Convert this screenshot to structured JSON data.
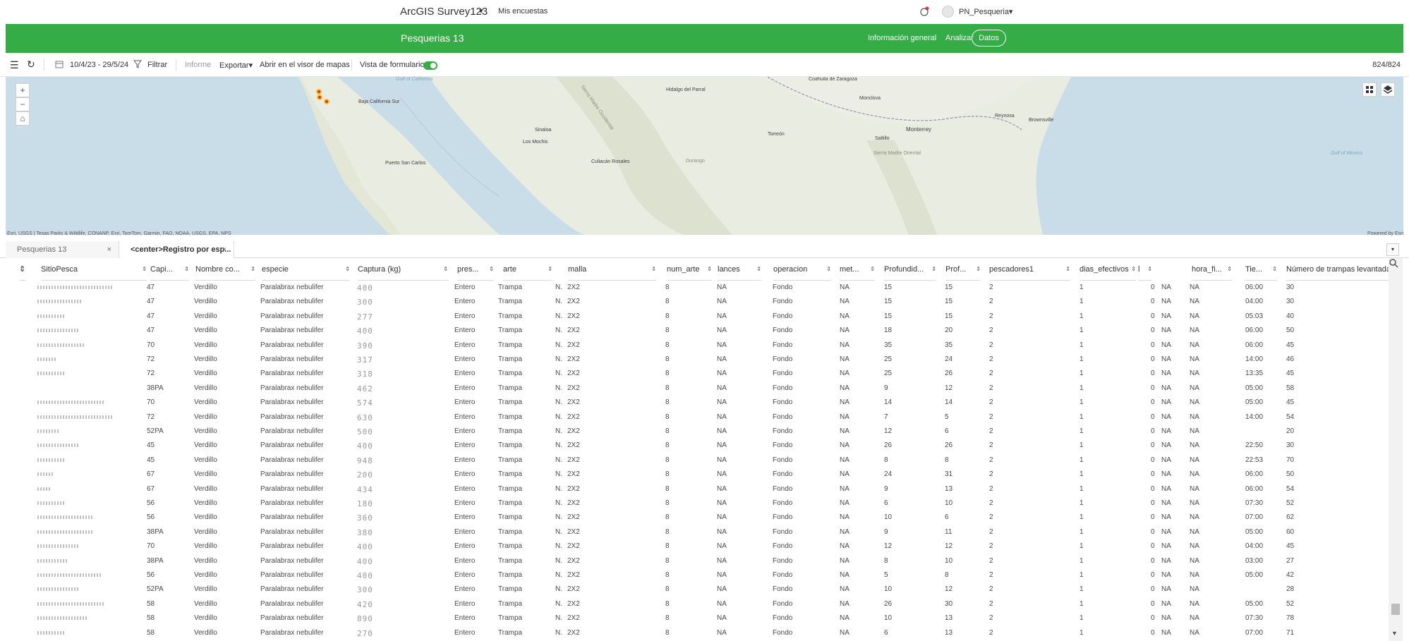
{
  "topbar": {
    "app_title": "ArcGIS Survey123",
    "app_caret": "▾",
    "mis_encuestas": "Mis encuestas",
    "user_name": "PN_Pesqueria▾"
  },
  "header": {
    "survey_title": "Pesquerias 13",
    "nav": {
      "info": "Información general",
      "analizar": "Analizar",
      "datos": "Datos"
    }
  },
  "toolbar": {
    "menu_icon": "☰",
    "refresh_icon": "↻",
    "date_range": "10/4/23 - 29/5/24",
    "filter": "Filtrar",
    "report": "Informe",
    "export": "Exportar▾",
    "open_map": "Abrir en el visor de mapas",
    "form_view": "Vista de formulario",
    "record_count": "824/824"
  },
  "map": {
    "zoom_in": "+",
    "zoom_out": "−",
    "home": "⌂",
    "labels": [
      {
        "text": "Gulf of California",
        "water": true
      },
      {
        "text": "Baja California Sur",
        "water": false
      },
      {
        "text": "Hidalgo del Parral",
        "water": false
      },
      {
        "text": "Coahuila de Zaragoza",
        "water": false
      },
      {
        "text": "Monclova",
        "water": false
      },
      {
        "text": "Sinaloa",
        "water": false
      },
      {
        "text": "Los Mochis",
        "water": false
      },
      {
        "text": "Sierra Madre Occidental",
        "water": false
      },
      {
        "text": "Reynosa",
        "water": false
      },
      {
        "text": "Brownsville",
        "water": false
      },
      {
        "text": "Monterrey",
        "water": false
      },
      {
        "text": "Torreón",
        "water": false
      },
      {
        "text": "Saltillo",
        "water": false
      },
      {
        "text": "Sierra Madre Oriental",
        "water": false
      },
      {
        "text": "Puerto San Carlos",
        "water": false
      },
      {
        "text": "Culiacán Rosales",
        "water": false
      },
      {
        "text": "Durango",
        "water": false
      },
      {
        "text": "Gulf of Mexico",
        "water": true
      }
    ],
    "attribution": "Esri, USGS | Texas Parks & Wildlife, CONANP, Esri, TomTom, Garmin, FAO, NOAA, USGS, EPA, NPS",
    "powered_by": "Powered by Esri"
  },
  "tabs": [
    {
      "label": "Pesquerias 13",
      "close": "×"
    },
    {
      "label": "<center>Registro por esp...",
      "close": "×"
    }
  ],
  "table": {
    "headers": [
      "SitioPesca",
      "Capi...",
      "Nombre co...",
      "especie",
      "Captura (kg)",
      "pres...",
      "arte",
      "malla",
      "num_arte",
      "lances",
      "operacion",
      "met...",
      "Profundid...",
      "Prof...",
      "pescadores1",
      "dias_efectivos",
      "l",
      "hora_fi...",
      "Tie...",
      "Número de trampas levantadas..."
    ],
    "sort_glyph": "⇕",
    "common": {
      "nombre": "Verdillo",
      "especie": "Paralabrax nebulifer",
      "pres": "Entero",
      "arte": "Trampa",
      "n": "N.",
      "malla": "2X2",
      "num_arte": "8",
      "lances": "NA",
      "operacion": "Fondo",
      "met": "NA",
      "pesc": "2",
      "dias": "1",
      "zero": "0",
      "na1": "NA",
      "na2": "NA"
    },
    "rows": [
      {
        "capi": "47",
        "blur": "400",
        "prof1": "15",
        "prof2": "15",
        "tie": "06:00",
        "trampas": "30"
      },
      {
        "capi": "47",
        "blur": "300",
        "prof1": "15",
        "prof2": "15",
        "tie": "04:00",
        "trampas": "30"
      },
      {
        "capi": "47",
        "blur": "277",
        "prof1": "15",
        "prof2": "15",
        "tie": "05:03",
        "trampas": "40"
      },
      {
        "capi": "47",
        "blur": "400",
        "prof1": "18",
        "prof2": "20",
        "tie": "06:00",
        "trampas": "50"
      },
      {
        "capi": "70",
        "blur": "390",
        "prof1": "35",
        "prof2": "35",
        "tie": "06:00",
        "trampas": "45"
      },
      {
        "capi": "72",
        "blur": "317",
        "prof1": "25",
        "prof2": "24",
        "tie": "14:00",
        "trampas": "46"
      },
      {
        "capi": "72",
        "blur": "318",
        "prof1": "25",
        "prof2": "26",
        "tie": "13:35",
        "trampas": "45"
      },
      {
        "capi": "38PA",
        "blur": "462",
        "prof1": "9",
        "prof2": "12",
        "tie": "05:00",
        "trampas": "58"
      },
      {
        "capi": "70",
        "blur": "574",
        "prof1": "14",
        "prof2": "14",
        "tie": "05:00",
        "trampas": "45"
      },
      {
        "capi": "72",
        "blur": "630",
        "prof1": "7",
        "prof2": "5",
        "tie": "14:00",
        "trampas": "54"
      },
      {
        "capi": "52PA",
        "blur": "500",
        "prof1": "12",
        "prof2": "6",
        "tie": "",
        "trampas": "20"
      },
      {
        "capi": "45",
        "blur": "400",
        "prof1": "26",
        "prof2": "26",
        "tie": "22:50",
        "trampas": "30"
      },
      {
        "capi": "45",
        "blur": "948",
        "prof1": "8",
        "prof2": "8",
        "tie": "22:53",
        "trampas": "70"
      },
      {
        "capi": "67",
        "blur": "200",
        "prof1": "24",
        "prof2": "31",
        "tie": "06:00",
        "trampas": "50"
      },
      {
        "capi": "67",
        "blur": "434",
        "prof1": "9",
        "prof2": "13",
        "tie": "06:00",
        "trampas": "54"
      },
      {
        "capi": "56",
        "blur": "180",
        "prof1": "6",
        "prof2": "10",
        "tie": "07:30",
        "trampas": "52"
      },
      {
        "capi": "56",
        "blur": "360",
        "prof1": "10",
        "prof2": "6",
        "tie": "07:00",
        "trampas": "62"
      },
      {
        "capi": "38PA",
        "blur": "380",
        "prof1": "9",
        "prof2": "11",
        "tie": "05:00",
        "trampas": "60"
      },
      {
        "capi": "70",
        "blur": "400",
        "prof1": "12",
        "prof2": "12",
        "tie": "04:00",
        "trampas": "45"
      },
      {
        "capi": "38PA",
        "blur": "400",
        "prof1": "8",
        "prof2": "10",
        "tie": "03:00",
        "trampas": "27"
      },
      {
        "capi": "56",
        "blur": "400",
        "prof1": "5",
        "prof2": "8",
        "tie": "05:00",
        "trampas": "42"
      },
      {
        "capi": "52PA",
        "blur": "300",
        "prof1": "10",
        "prof2": "12",
        "tie": "",
        "trampas": "28"
      },
      {
        "capi": "58",
        "blur": "420",
        "prof1": "26",
        "prof2": "30",
        "tie": "05:00",
        "trampas": "52"
      },
      {
        "capi": "58",
        "blur": "890",
        "prof1": "10",
        "prof2": "13",
        "tie": "07:30",
        "trampas": "78"
      },
      {
        "capi": "58",
        "blur": "270",
        "prof1": "6",
        "prof2": "13",
        "tie": "07:00",
        "trampas": "71"
      }
    ]
  },
  "colors": {
    "green": "#35ac46",
    "red_dot": "#e0302a",
    "yellow_ring": "#f3c430"
  },
  "scrollbar": {
    "down": "▼"
  }
}
